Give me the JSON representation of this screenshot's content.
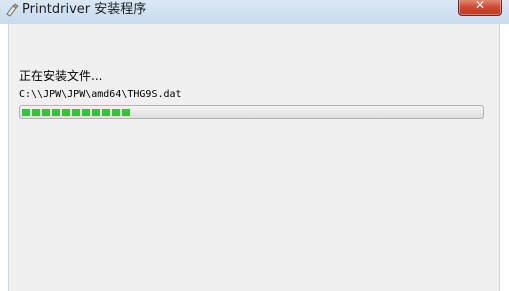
{
  "window": {
    "title": "Printdriver 安装程序",
    "icon": "installer-icon",
    "close_glyph": "✕"
  },
  "install": {
    "status_text": "正在安装文件...",
    "file_path": "C:\\\\JPW\\JPW\\amd64\\THG9S.dat",
    "progress_fraction": 0.24,
    "progress_color": "#2ec63a"
  }
}
